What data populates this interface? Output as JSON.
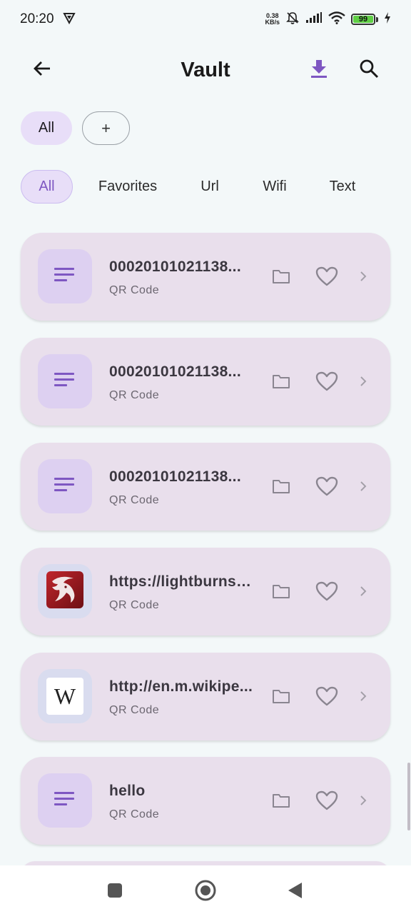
{
  "status_bar": {
    "time": "20:20",
    "net_speed_value": "0.38",
    "net_speed_unit": "KB/s",
    "battery": "99"
  },
  "app_bar": {
    "title": "Vault",
    "back_icon": "arrow-left-icon",
    "download_icon": "download-icon",
    "search_icon": "search-icon"
  },
  "folders": {
    "selected": "All",
    "add_label": "+"
  },
  "filters": [
    "All",
    "Favorites",
    "Url",
    "Wifi",
    "Text"
  ],
  "active_filter": "All",
  "items": [
    {
      "title": "00020101021138...",
      "subtitle": "QR Code",
      "icon": "text-lines-icon"
    },
    {
      "title": "00020101021138...",
      "subtitle": "QR Code",
      "icon": "text-lines-icon"
    },
    {
      "title": "00020101021138...",
      "subtitle": "QR Code",
      "icon": "text-lines-icon"
    },
    {
      "title": "https://lightburnso...",
      "subtitle": "QR Code",
      "icon": "lightburn-dragon-logo"
    },
    {
      "title": "http://en.m.wikipe...",
      "subtitle": "QR Code",
      "icon": "wikipedia-logo",
      "logo_text": "W"
    },
    {
      "title": "hello",
      "subtitle": "QR Code",
      "icon": "text-lines-icon"
    }
  ],
  "colors": {
    "accent": "#7e57c2",
    "chip_bg": "#e8def8",
    "card_bg": "#e9dfec",
    "background": "#f3f8f9"
  }
}
